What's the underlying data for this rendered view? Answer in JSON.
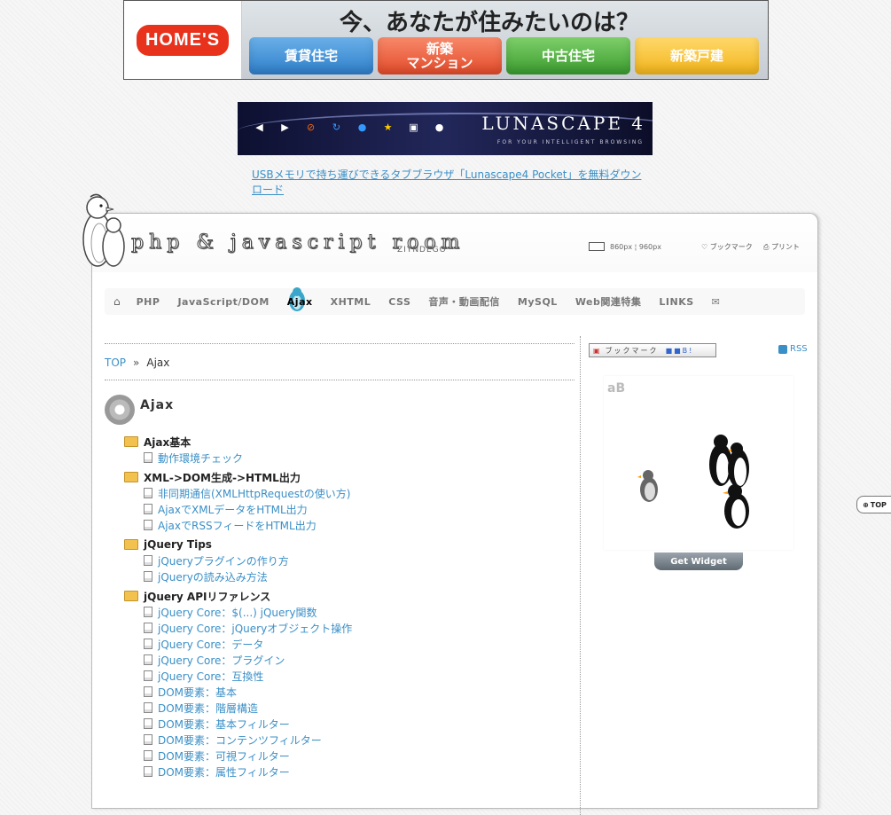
{
  "ads": {
    "homes": {
      "logo": "HOME'S",
      "headline": "今、あなたが住みたいのは？",
      "buttons": [
        "賃貸住宅",
        "新築\nマンション",
        "中古住宅",
        "新築戸建"
      ]
    },
    "lunascape": {
      "logo": "LUNASCAPE 4",
      "tagline": "FOR YOUR INTELLIGENT BROWSING",
      "link_text": "USBメモリで持ち運びできるタブブラウザ「Lunascape4 Pocket」を無料ダウンロード"
    }
  },
  "header": {
    "site_title": "php & javascript room",
    "subtitle": "ZIYNDEGO",
    "width_options": "860px ¦ 960px",
    "bookmark": "ブックマーク",
    "print": "プリント"
  },
  "nav": {
    "items": [
      "PHP",
      "JavaScript/DOM",
      "Ajax",
      "XHTML",
      "CSS",
      "音声・動画配信",
      "MySQL",
      "Web関連特集",
      "LINKS"
    ],
    "active": "Ajax"
  },
  "breadcrumb": {
    "top": "TOP",
    "sep": "»",
    "current": "Ajax"
  },
  "page": {
    "heading": "Ajax"
  },
  "toc": [
    {
      "title": "Ajax基本",
      "links": [
        "動作環境チェック"
      ]
    },
    {
      "title": "XML->DOM生成->HTML出力",
      "links": [
        "非同期通信(XMLHttpRequestの使い方)",
        "AjaxでXMLデータをHTML出力",
        "AjaxでRSSフィードをHTML出力"
      ]
    },
    {
      "title": "jQuery Tips",
      "links": [
        "jQueryプラグインの作り方",
        "jQueryの読み込み方法"
      ]
    },
    {
      "title": "jQuery APIリファレンス",
      "links": [
        "jQuery Core：$(...) jQuery関数",
        "jQuery Core：jQueryオブジェクト操作",
        "jQuery Core：データ",
        "jQuery Core：プラグイン",
        "jQuery Core：互換性",
        "DOM要素：基本",
        "DOM要素：階層構造",
        "DOM要素：基本フィルター",
        "DOM要素：コンテンツフィルター",
        "DOM要素：可視フィルター",
        "DOM要素：属性フィルター"
      ]
    }
  ],
  "sidebar": {
    "bookmark_button": "ブックマーク",
    "rss": "RSS",
    "widget_badge": "aB",
    "get_widget": "Get Widget"
  },
  "top_button": "TOP"
}
